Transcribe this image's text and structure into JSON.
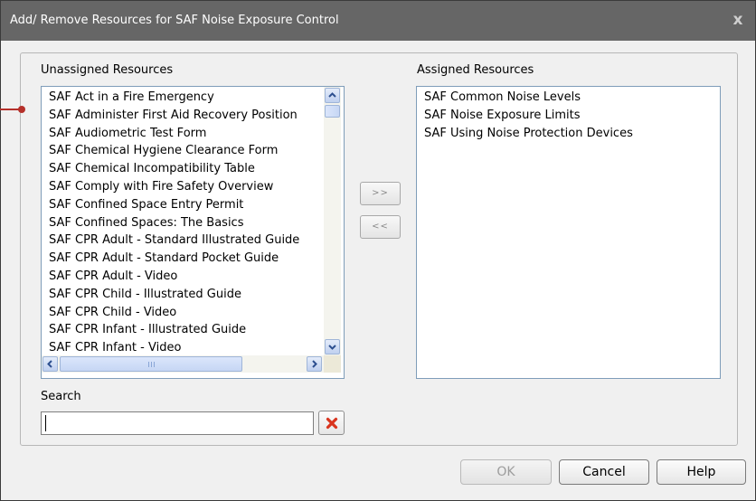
{
  "dialog": {
    "title": "Add/ Remove Resources for SAF  Noise Exposure Control",
    "close_glyph": "x"
  },
  "unassigned": {
    "label": "Unassigned Resources",
    "items": [
      "SAF  Act in a Fire Emergency",
      "SAF  Administer First Aid Recovery Position",
      "SAF  Audiometric Test Form",
      "SAF  Chemical Hygiene Clearance Form",
      "SAF  Chemical Incompatibility Table",
      "SAF  Comply with Fire Safety Overview",
      "SAF  Confined Space Entry Permit",
      "SAF  Confined Spaces: The Basics",
      "SAF  CPR Adult - Standard Illustrated Guide",
      "SAF  CPR Adult - Standard Pocket Guide",
      "SAF  CPR Adult - Video",
      "SAF  CPR Child - Illustrated Guide",
      "SAF  CPR Child - Video",
      "SAF  CPR Infant - Illustrated Guide",
      "SAF  CPR Infant - Video"
    ]
  },
  "assigned": {
    "label": "Assigned Resources",
    "items": [
      "SAF  Common Noise Levels",
      "SAF  Noise Exposure Limits",
      "SAF  Using Noise Protection Devices"
    ]
  },
  "move": {
    "add_label": ">>",
    "remove_label": "<<"
  },
  "search": {
    "label": "Search",
    "value": ""
  },
  "buttons": {
    "ok": "OK",
    "cancel": "Cancel",
    "help": "Help"
  },
  "colors": {
    "titlebar": "#666666",
    "clear_icon": "#d9341e",
    "annotation": "#b5302a"
  }
}
